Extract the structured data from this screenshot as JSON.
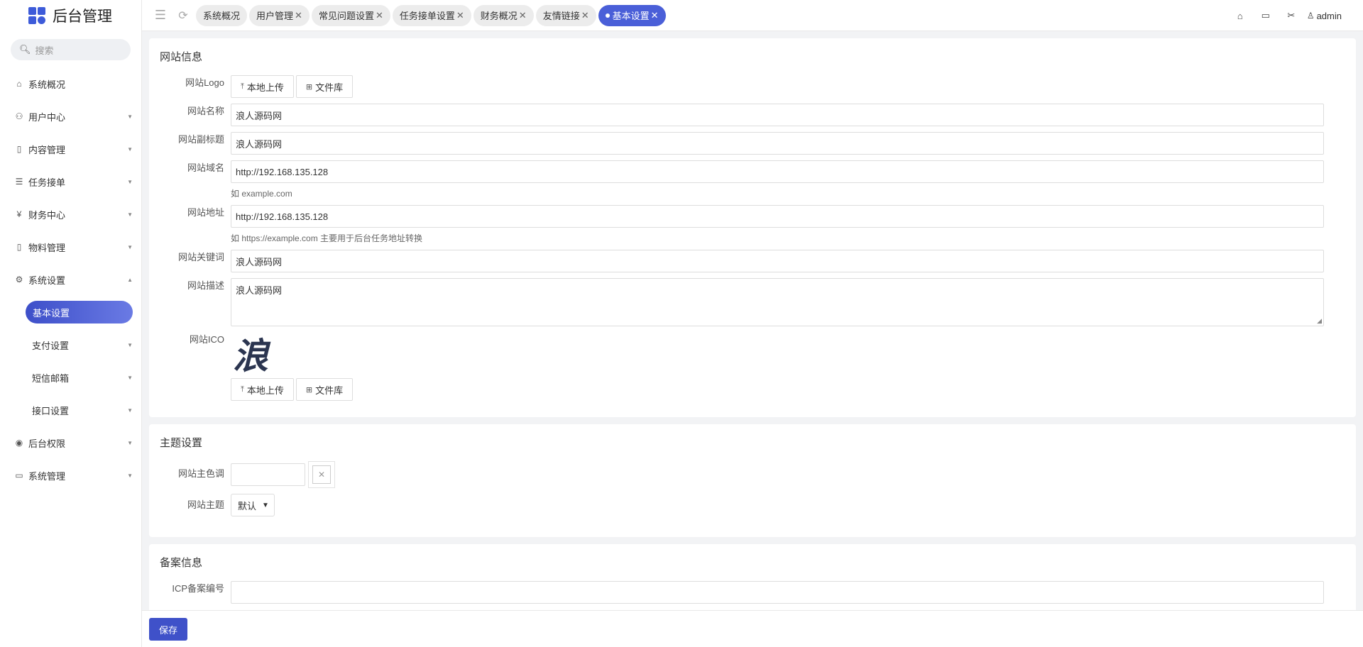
{
  "app": {
    "title": "后台管理"
  },
  "search": {
    "placeholder": "搜索"
  },
  "sidebar": {
    "items": [
      {
        "label": "系统概况",
        "icon": "home-icon"
      },
      {
        "label": "用户中心",
        "icon": "users-icon"
      },
      {
        "label": "内容管理",
        "icon": "document-icon"
      },
      {
        "label": "任务接单",
        "icon": "list-icon"
      },
      {
        "label": "财务中心",
        "icon": "yen-icon"
      },
      {
        "label": "物料管理",
        "icon": "document-icon"
      },
      {
        "label": "系统设置",
        "icon": "gear-icon"
      },
      {
        "label": "后台权限",
        "icon": "user-circle-icon"
      },
      {
        "label": "系统管理",
        "icon": "image-icon"
      }
    ],
    "sub_items": [
      {
        "label": "基本设置"
      },
      {
        "label": "支付设置"
      },
      {
        "label": "短信邮箱"
      },
      {
        "label": "接口设置"
      }
    ]
  },
  "tabs": [
    {
      "label": "系统概况"
    },
    {
      "label": "用户管理"
    },
    {
      "label": "常见问题设置"
    },
    {
      "label": "任务接单设置"
    },
    {
      "label": "财务概况"
    },
    {
      "label": "友情链接"
    },
    {
      "label": "基本设置"
    }
  ],
  "header": {
    "user": "admin"
  },
  "site_info": {
    "title": "网站信息",
    "logo_label": "网站Logo",
    "upload_label": "本地上传",
    "library_label": "文件库",
    "name_label": "网站名称",
    "name_value": "浪人源码网",
    "subtitle_label": "网站副标题",
    "subtitle_value": "浪人源码网",
    "domain_label": "网站域名",
    "domain_value": "http://192.168.135.128",
    "domain_hint": "如 example.com",
    "url_label": "网站地址",
    "url_value": "http://192.168.135.128",
    "url_hint": "如 https://example.com 主要用于后台任务地址转换",
    "keywords_label": "网站关键词",
    "keywords_value": "浪人源码网",
    "desc_label": "网站描述",
    "desc_value": "浪人源码网",
    "ico_label": "网站ICO",
    "ico_glyph": "浪"
  },
  "theme": {
    "title": "主题设置",
    "color_label": "网站主色调",
    "theme_label": "网站主题",
    "theme_value": "默认"
  },
  "record": {
    "title": "备案信息",
    "partial_label": "ICP备案编号"
  },
  "footer": {
    "save_label": "保存"
  },
  "colors": {
    "accent": "#3f51c9",
    "active_tab": "#4a5fd8"
  }
}
